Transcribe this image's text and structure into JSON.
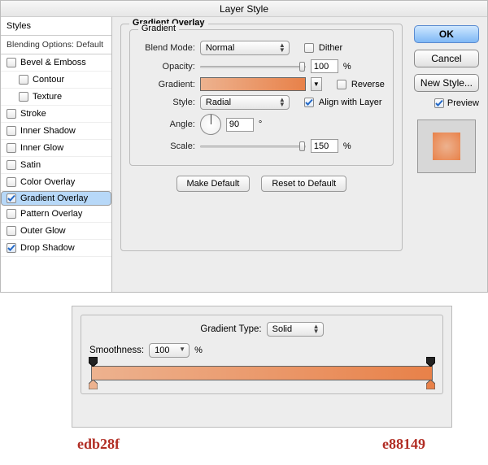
{
  "dialog": {
    "title": "Layer Style",
    "sidebar": {
      "header": "Styles",
      "subheader": "Blending Options: Default",
      "items": [
        {
          "label": "Bevel & Emboss",
          "checked": false,
          "indent": false
        },
        {
          "label": "Contour",
          "checked": false,
          "indent": true
        },
        {
          "label": "Texture",
          "checked": false,
          "indent": true
        },
        {
          "label": "Stroke",
          "checked": false,
          "indent": false
        },
        {
          "label": "Inner Shadow",
          "checked": false,
          "indent": false
        },
        {
          "label": "Inner Glow",
          "checked": false,
          "indent": false
        },
        {
          "label": "Satin",
          "checked": false,
          "indent": false
        },
        {
          "label": "Color Overlay",
          "checked": false,
          "indent": false
        },
        {
          "label": "Gradient Overlay",
          "checked": true,
          "indent": false,
          "selected": true
        },
        {
          "label": "Pattern Overlay",
          "checked": false,
          "indent": false
        },
        {
          "label": "Outer Glow",
          "checked": false,
          "indent": false
        },
        {
          "label": "Drop Shadow",
          "checked": true,
          "indent": false
        }
      ]
    },
    "panel": {
      "title": "Gradient Overlay",
      "inner_title": "Gradient",
      "labels": {
        "blend_mode": "Blend Mode:",
        "opacity": "Opacity:",
        "gradient": "Gradient:",
        "style": "Style:",
        "angle": "Angle:",
        "scale": "Scale:"
      },
      "blend_mode_value": "Normal",
      "dither_label": "Dither",
      "dither_checked": false,
      "opacity_value": "100",
      "opacity_unit": "%",
      "reverse_label": "Reverse",
      "reverse_checked": false,
      "style_value": "Radial",
      "align_label": "Align with Layer",
      "align_checked": true,
      "angle_value": "90",
      "angle_unit": "°",
      "scale_value": "150",
      "scale_unit": "%",
      "make_default": "Make Default",
      "reset_default": "Reset to Default"
    },
    "buttons": {
      "ok": "OK",
      "cancel": "Cancel",
      "new_style": "New Style...",
      "preview": "Preview",
      "preview_checked": true
    }
  },
  "gradient_editor": {
    "type_label": "Gradient Type:",
    "type_value": "Solid",
    "smoothness_label": "Smoothness:",
    "smoothness_value": "100",
    "smoothness_unit": "%",
    "left_hex": "edb28f",
    "right_hex": "e88149"
  }
}
